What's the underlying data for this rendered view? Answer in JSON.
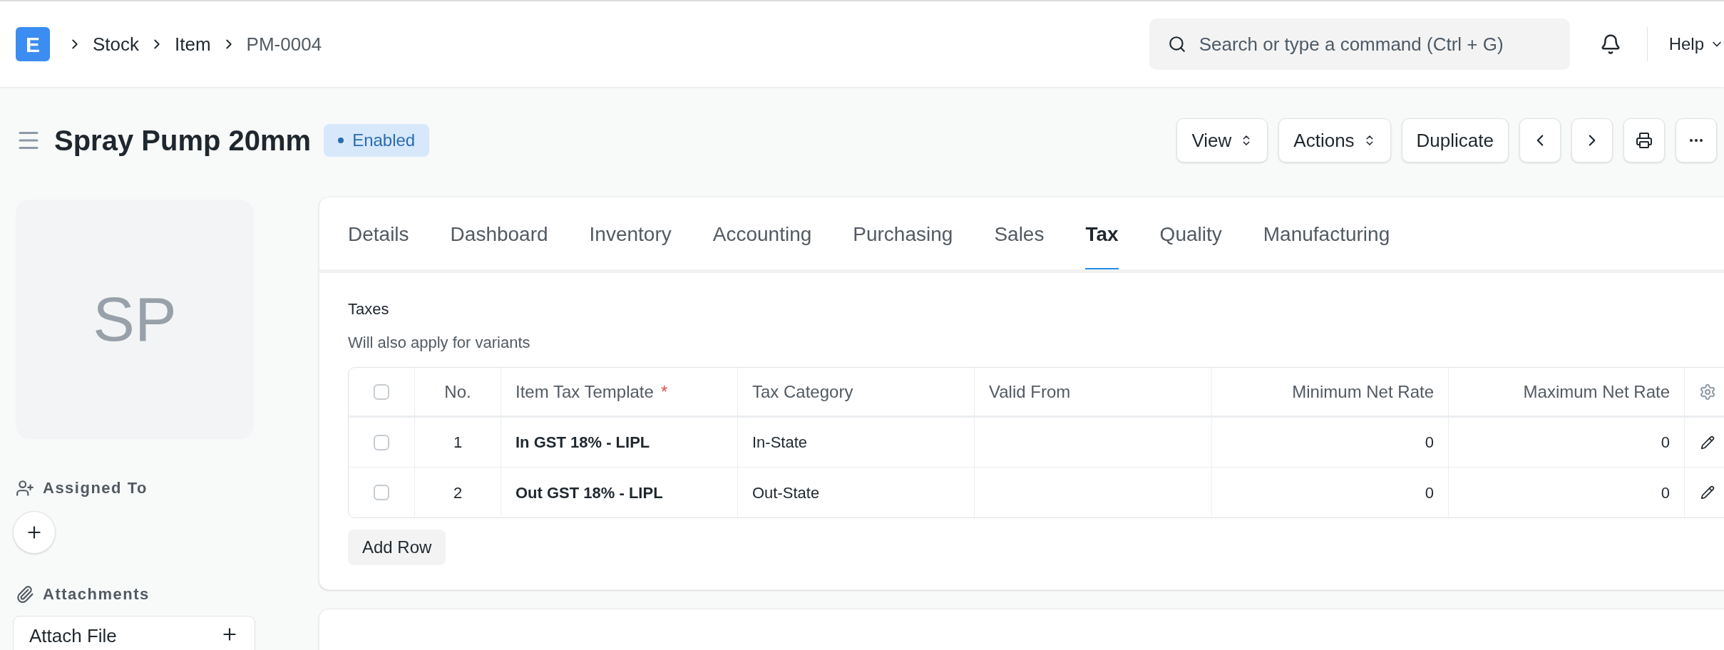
{
  "navbar": {
    "logo": "E",
    "breadcrumbs": [
      {
        "label": "Stock",
        "current": false
      },
      {
        "label": "Item",
        "current": false
      },
      {
        "label": "PM-0004",
        "current": true
      }
    ],
    "search": {
      "placeholder": "Search or type a command (Ctrl + G)"
    },
    "help": "Help"
  },
  "page": {
    "title": "Spray Pump 20mm",
    "status": {
      "label": "Enabled",
      "color": "#2b6cb0"
    }
  },
  "toolbar": [
    {
      "kind": "dropdown",
      "label": "View"
    },
    {
      "kind": "dropdown",
      "label": "Actions"
    },
    {
      "kind": "plain",
      "label": "Duplicate"
    },
    {
      "kind": "prev"
    },
    {
      "kind": "next"
    },
    {
      "kind": "print"
    },
    {
      "kind": "more"
    }
  ],
  "sidebar": {
    "avatar": "SP",
    "assigned_to": "Assigned To",
    "attachments": "Attachments",
    "attach_file": "Attach File"
  },
  "tabs": [
    {
      "label": "Details",
      "selected": false
    },
    {
      "label": "Dashboard",
      "selected": false
    },
    {
      "label": "Inventory",
      "selected": false
    },
    {
      "label": "Accounting",
      "selected": false
    },
    {
      "label": "Purchasing",
      "selected": false
    },
    {
      "label": "Sales",
      "selected": false
    },
    {
      "label": "Tax",
      "selected": true
    },
    {
      "label": "Quality",
      "selected": false
    },
    {
      "label": "Manufacturing",
      "selected": false
    }
  ],
  "section": {
    "label": "Taxes",
    "description": "Will also apply for variants"
  },
  "table": {
    "header_checked": false,
    "columns": [
      {
        "label": "No.",
        "kind": "index"
      },
      {
        "label": "Item Tax Template",
        "kind": "link",
        "required_mark": "*"
      },
      {
        "label": "Tax Category",
        "kind": "text"
      },
      {
        "label": "Valid From",
        "kind": "text"
      },
      {
        "label": "Minimum Net Rate",
        "kind": "number"
      },
      {
        "label": "Maximum Net Rate",
        "kind": "number"
      }
    ],
    "rows": [
      {
        "checked": false,
        "cells": [
          "1",
          "In GST 18% - LIPL",
          "In-State",
          "",
          "0",
          "0"
        ]
      },
      {
        "checked": false,
        "cells": [
          "2",
          "Out GST 18% - LIPL",
          "Out-State",
          "",
          "0",
          "0"
        ]
      }
    ],
    "add_row": "Add Row"
  }
}
